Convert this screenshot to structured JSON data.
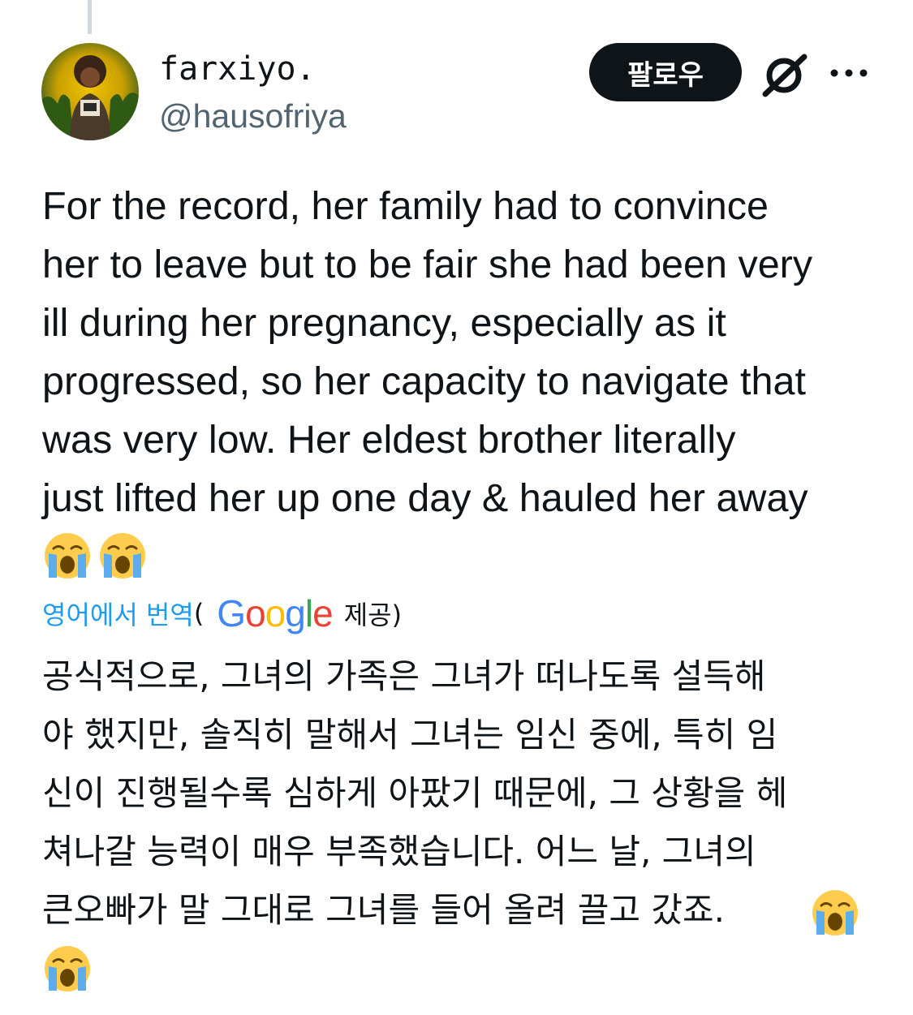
{
  "tweet": {
    "display_name": "farxiyo.",
    "handle": "@hausofriya",
    "follow_label": "팔로우",
    "text": "For the record, her family had to convince\nher to leave but to be fair she had been very\nill during her pregnancy, especially as it\nprogressed, so her capacity to navigate that\nwas very low. Her eldest brother literally\njust lifted her up one day & hauled her away",
    "emojis": [
      "loudly-crying-face",
      "loudly-crying-face"
    ]
  },
  "translation": {
    "link_label": "영어에서 번역",
    "open_paren": "(",
    "provider": "Google",
    "provided_label": "제공)",
    "text": "공식적으로, 그녀의 가족은 그녀가 떠나도록 설득해\n야 했지만, 솔직히 말해서 그녀는 임신 중에, 특히 임\n신이 진행될수록 심하게 아팠기 때문에, 그 상황을 헤\n쳐나갈 능력이 매우 부족했습니다. 어느 날, 그녀의\n큰오빠가 말 그대로 그녀를 들어 올려 끌고 갔죠.",
    "emojis": [
      "loudly-crying-face",
      "loudly-crying-face"
    ]
  },
  "icons": {
    "grok": "grok-icon",
    "more": "more-icon"
  },
  "colors": {
    "link_blue": "#1d9bf0",
    "text_primary": "#0f1419",
    "text_secondary": "#536471",
    "google_blue": "#4285F4",
    "google_red": "#EA4335",
    "google_yellow": "#FBBC05",
    "google_green": "#34A853"
  }
}
